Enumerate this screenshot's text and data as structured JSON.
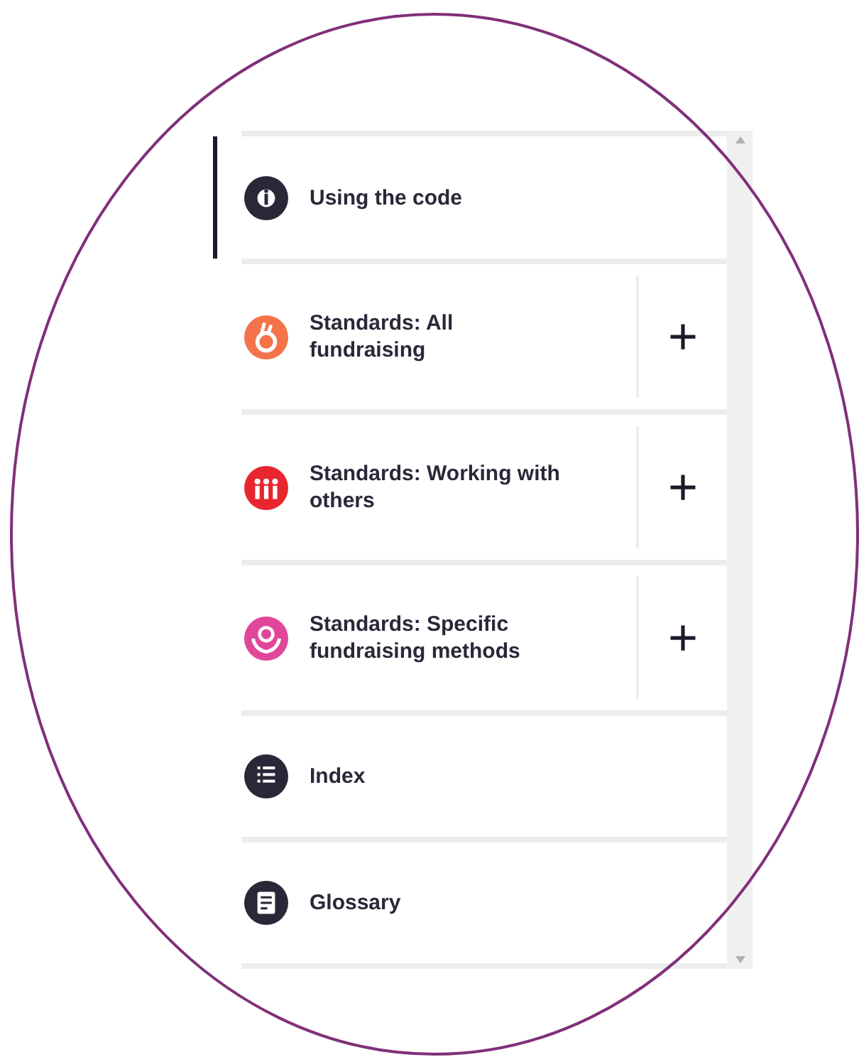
{
  "menu": {
    "items": [
      {
        "label": "Using the code",
        "kind": "link",
        "selected": true,
        "color": "#2a2838"
      },
      {
        "label": "Standards: All fundraising",
        "kind": "group",
        "selected": false,
        "expanded": false,
        "toggle": "+",
        "color": "#f4734a"
      },
      {
        "label": "Standards: Working with others",
        "kind": "group",
        "selected": false,
        "expanded": false,
        "toggle": "+",
        "color": "#e8262f"
      },
      {
        "label": "Standards: Specific fundraising methods",
        "kind": "group",
        "selected": false,
        "expanded": false,
        "toggle": "+",
        "color": "#e0469a"
      },
      {
        "label": "Index",
        "kind": "link",
        "selected": false,
        "color": "#2a2838"
      },
      {
        "label": "Glossary",
        "kind": "link",
        "selected": false,
        "color": "#2a2838"
      }
    ]
  }
}
